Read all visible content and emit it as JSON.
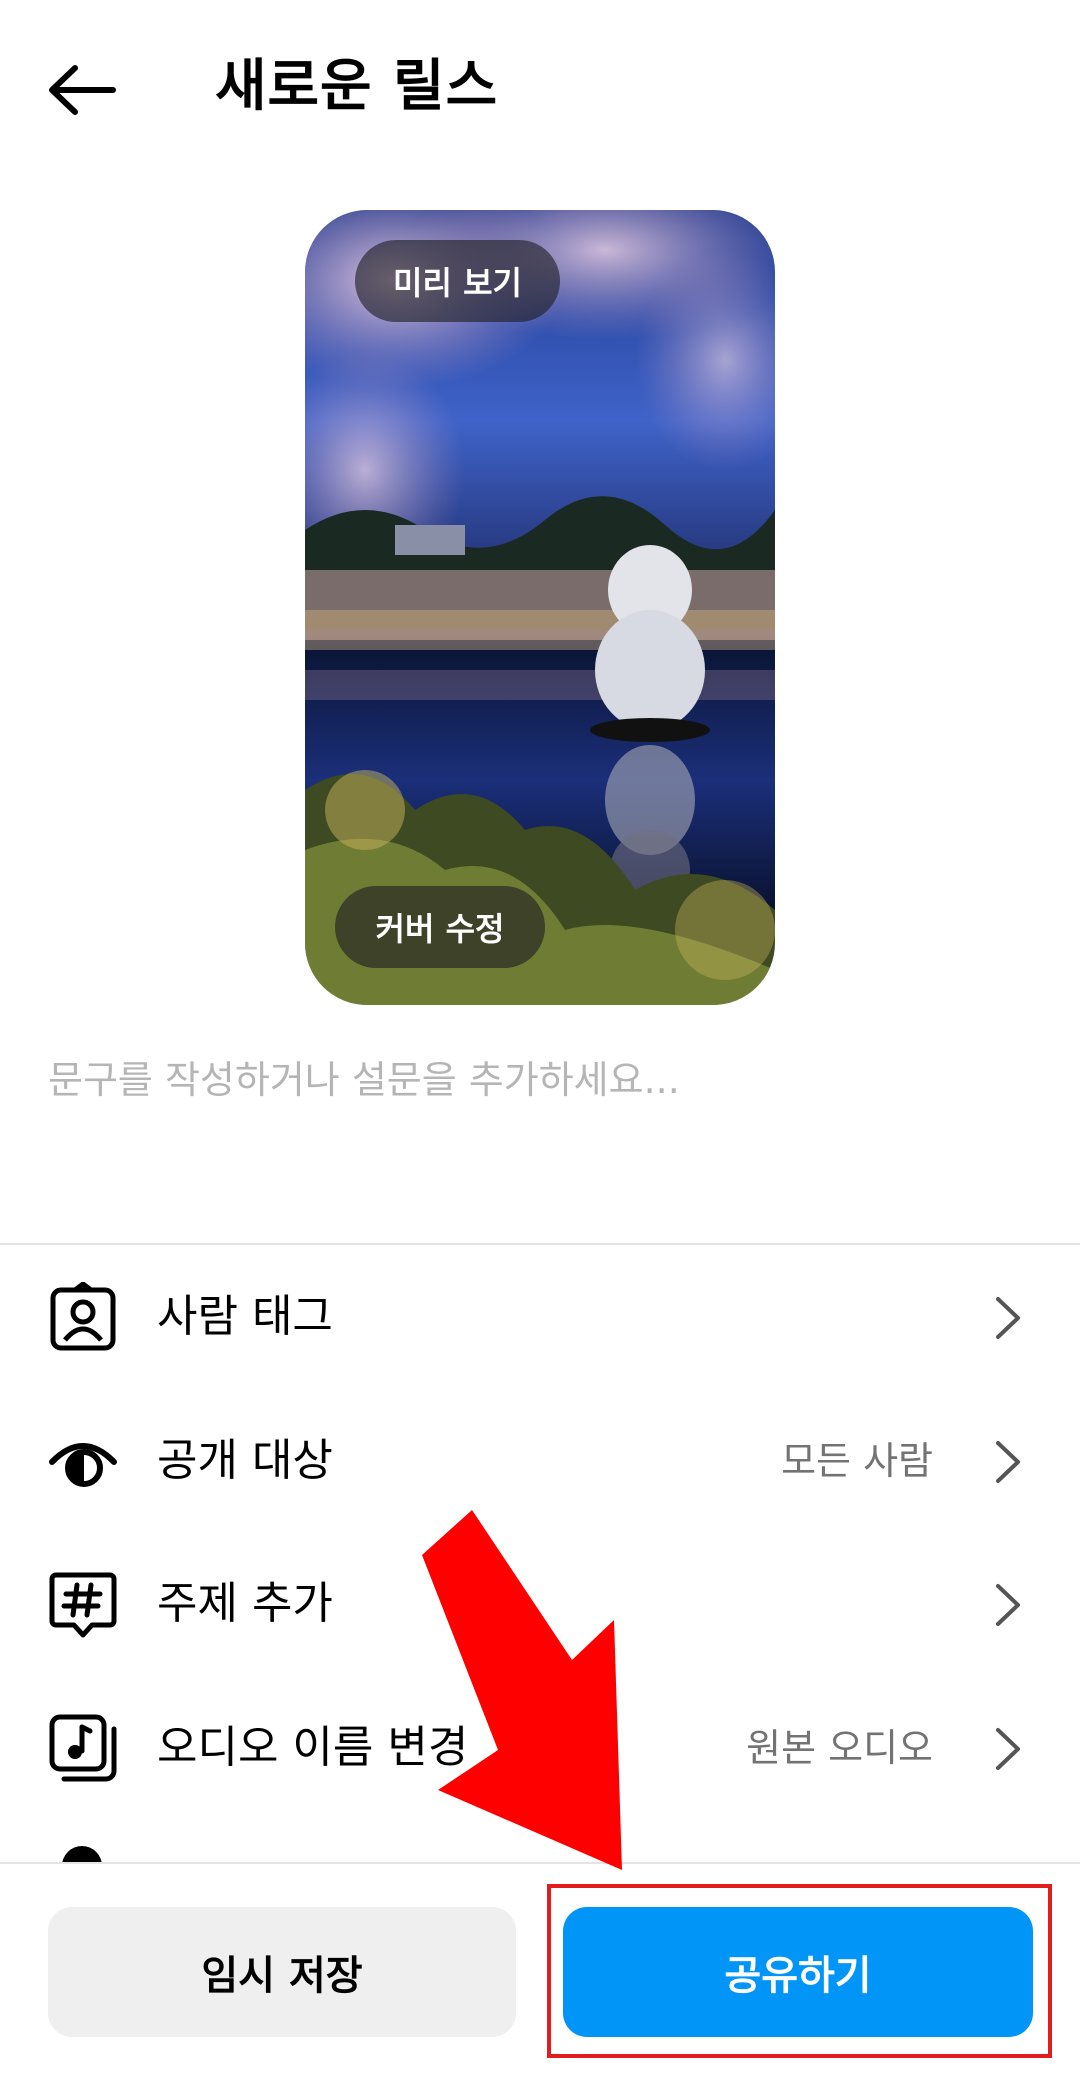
{
  "header": {
    "title": "새로운 릴스"
  },
  "preview": {
    "preview_label": "미리 보기",
    "cover_label": "커버 수정"
  },
  "caption": {
    "placeholder": "문구를 작성하거나 설문을 추가하세요..."
  },
  "menu": {
    "items": [
      {
        "label": "사람 태그",
        "value": "",
        "icon": "person-tag-icon"
      },
      {
        "label": "공개 대상",
        "value": "모든 사람",
        "icon": "eye-icon"
      },
      {
        "label": "주제 추가",
        "value": "",
        "icon": "hashtag-icon"
      },
      {
        "label": "오디오 이름 변경",
        "value": "원본 오디오",
        "icon": "music-note-icon"
      }
    ]
  },
  "bottom": {
    "draft_label": "임시 저장",
    "share_label": "공유하기"
  },
  "colors": {
    "share_button": "#0095f6",
    "draft_button": "#efefef",
    "highlight": "#e11d1d",
    "annotation_arrow": "#ff0000"
  }
}
